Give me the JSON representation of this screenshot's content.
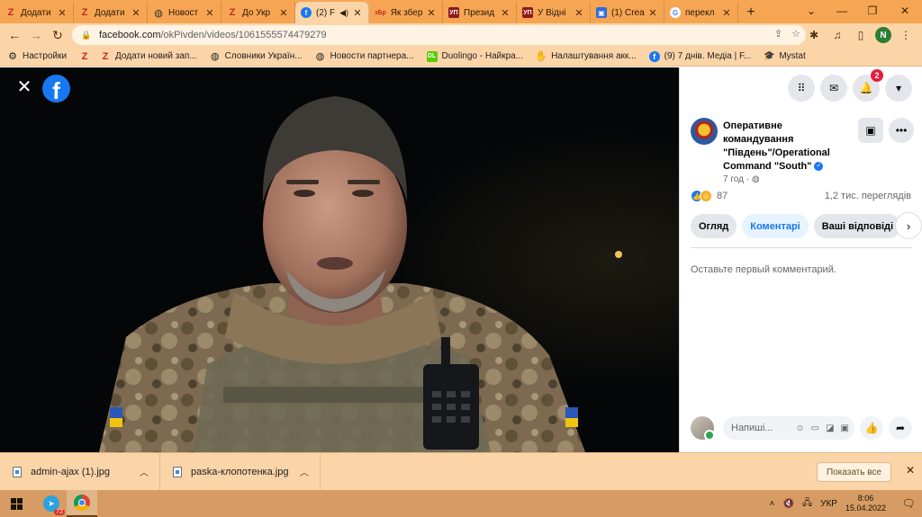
{
  "browser": {
    "tabs": [
      {
        "label": "Додати",
        "icon": "z-logo-icon",
        "active": false
      },
      {
        "label": "Додати",
        "icon": "z-logo-icon",
        "active": false
      },
      {
        "label": "Новост",
        "icon": "globe-icon",
        "active": false
      },
      {
        "label": "До Укр",
        "icon": "z-logo-icon",
        "active": false
      },
      {
        "label": "(2) F",
        "icon": "facebook-icon",
        "active": true
      },
      {
        "label": "Як збер",
        "icon": "zbr-logo-icon",
        "active": false
      },
      {
        "label": "Презид",
        "icon": "up-logo-icon",
        "active": false
      },
      {
        "label": "У Відні",
        "icon": "up-logo-icon",
        "active": false
      },
      {
        "label": "(1) Crea",
        "icon": "blue-square-icon",
        "active": false
      },
      {
        "label": "перекл",
        "icon": "google-icon",
        "active": false
      }
    ],
    "address": {
      "host": "facebook.com",
      "path": "/okPivden/videos/1061555574479279"
    },
    "profile_initial": "N",
    "bookmarks": [
      {
        "label": "Настройки",
        "icon": "gear-icon"
      },
      {
        "label": "",
        "icon": "z-logo-icon"
      },
      {
        "label": "Додати новий зап...",
        "icon": "z-logo-icon"
      },
      {
        "label": "Словники Україн...",
        "icon": "globe-icon"
      },
      {
        "label": "Новости партнера...",
        "icon": "globe-icon"
      },
      {
        "label": "Duolingo - Найкра...",
        "icon": "duolingo-icon"
      },
      {
        "label": "Налаштування акк...",
        "icon": "hand-icon"
      },
      {
        "label": "(9) 7 днів. Медіа | F...",
        "icon": "facebook-icon"
      },
      {
        "label": "Mystat",
        "icon": "graduation-cap-icon"
      }
    ]
  },
  "video": {
    "close_glyph": "✕",
    "logo_letter": "f"
  },
  "panel": {
    "notifications_count": "2",
    "page_name_line1": "Оперативне",
    "page_name_line2": "командування",
    "page_name_line3": "\"Південь\"/Operational",
    "page_name_line4": "Command \"South\"",
    "time": "7 год · ",
    "reactions_count": "87",
    "views": "1,2 тис. переглядів",
    "tabs": [
      "Огляд",
      "Коментарі",
      "Ваші відповіді"
    ],
    "active_tab_index": 1,
    "empty_comments": "Оставьте первый комментарий.",
    "comment_placeholder": "Напиші..."
  },
  "downloads": {
    "items": [
      "admin-ajax (1).jpg",
      "paska-клопотенка.jpg"
    ],
    "show_all": "Показать все"
  },
  "taskbar": {
    "telegram_badge": "72",
    "language": "УКР",
    "time": "8:06",
    "date": "15.04.2022"
  },
  "colors": {
    "tab_strip": "#f6a553",
    "toolbar": "#fbd5a8",
    "facebook_blue": "#1877f2",
    "notification_red": "#e41e3f",
    "taskbar": "#d69c63"
  }
}
